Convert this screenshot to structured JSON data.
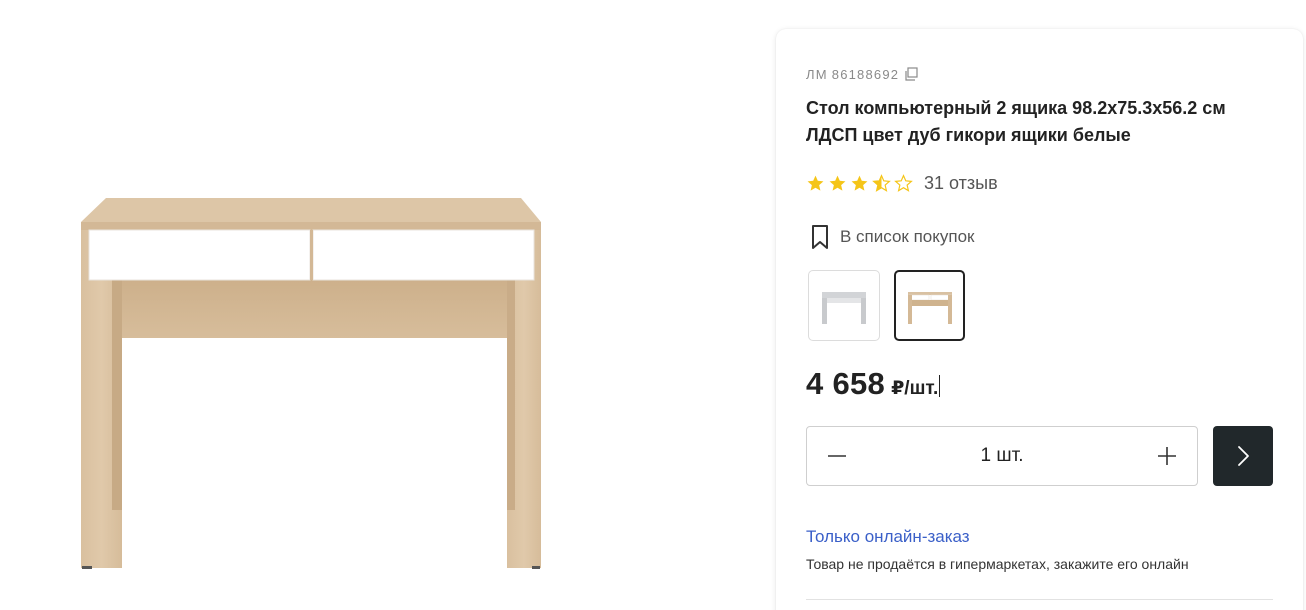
{
  "product": {
    "article_prefix": "ЛМ",
    "article_number": "86188692",
    "title": "Стол компьютерный 2 ящика 98.2x75.3x56.2 см ЛДСП цвет дуб гикори ящики белые",
    "rating": 3.5,
    "rating_max": 5,
    "reviews_label": "31 отзыв",
    "shopping_list_label": "В список покупок",
    "price_value": "4 658",
    "price_unit": "₽/шт.",
    "quantity_label": "1 шт.",
    "online_only_label": "Только онлайн-заказ",
    "online_only_note": "Товар не продаётся в гипермаркетах, закажите его онлайн"
  },
  "variants": [
    {
      "name": "white",
      "selected": false
    },
    {
      "name": "hickory-oak",
      "selected": true
    }
  ],
  "colors": {
    "star": "#f5c518",
    "link": "#3a5fc8",
    "button_dark": "#21282b",
    "oak": "#dbc3a4",
    "drawer_white": "#ffffff"
  },
  "icons": {
    "copy": "copy-icon",
    "bookmark": "bookmark-icon",
    "minus": "minus-icon",
    "plus": "plus-icon",
    "next": "chevron-right-icon"
  }
}
